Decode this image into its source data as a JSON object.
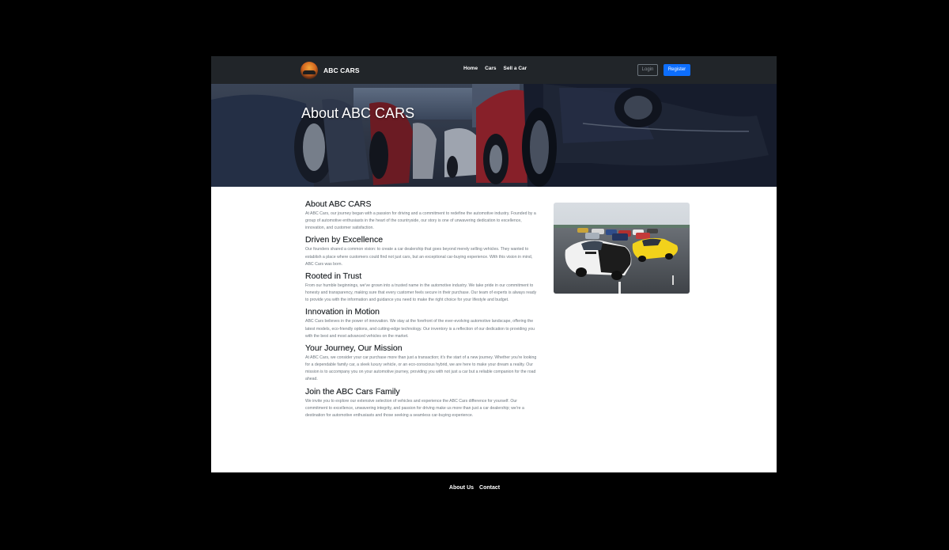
{
  "navbar": {
    "brand": "ABC CARS",
    "links": [
      "Home",
      "Cars",
      "Sell a Car"
    ],
    "login_label": "Login",
    "register_label": "Register"
  },
  "hero": {
    "title": "About ABC CARS"
  },
  "sections": [
    {
      "heading": "About ABC CARS",
      "body": "At ABC Cars, our journey began with a passion for driving and a commitment to redefine the automotive industry. Founded by a group of automotive enthusiasts in the heart of the countryside, our story is one of unwavering dedication to excellence, innovation, and customer satisfaction."
    },
    {
      "heading": "Driven by Excellence",
      "body": "Our founders shared a common vision: to create a car dealership that goes beyond merely selling vehicles. They wanted to establish a place where customers could find not just cars, but an exceptional car-buying experience. With this vision in mind, ABC Cars was born."
    },
    {
      "heading": "Rooted in Trust",
      "body": "From our humble beginnings, we've grown into a trusted name in the automotive industry. We take pride in our commitment to honesty and transparency, making sure that every customer feels secure in their purchase. Our team of experts is always ready to provide you with the information and guidance you need to make the right choice for your lifestyle and budget."
    },
    {
      "heading": "Innovation in Motion",
      "body": "ABC Cars believes in the power of innovation. We stay at the forefront of the ever-evolving automotive landscape, offering the latest models, eco-friendly options, and cutting-edge technology. Our inventory is a reflection of our dedication to providing you with the best and most advanced vehicles on the market."
    },
    {
      "heading": "Your Journey, Our Mission",
      "body": "At ABC Cars, we consider your car purchase more than just a transaction; it's the start of a new journey. Whether you're looking for a dependable family car, a sleek luxury vehicle, or an eco-conscious hybrid, we are here to make your dream a reality. Our mission is to accompany you on your automotive journey, providing you with not just a car but a reliable companion for the road ahead."
    },
    {
      "heading": "Join the ABC Cars Family",
      "body": "We invite you to explore our extensive selection of vehicles and experience the ABC Cars difference for yourself. Our commitment to excellence, unwavering integrity, and passion for driving make us more than just a car dealership; we're a destination for automotive enthusiasts and those seeking a seamless car-buying experience."
    }
  ],
  "footer": {
    "links": [
      "About Us",
      "Contact"
    ]
  },
  "colors": {
    "navbar_bg": "#212529",
    "primary": "#0d6efd",
    "heading": "#212529",
    "body_text": "#6c757d",
    "backdrop": "#000000"
  },
  "icons": {
    "brand_logo": "car-logo-icon"
  }
}
